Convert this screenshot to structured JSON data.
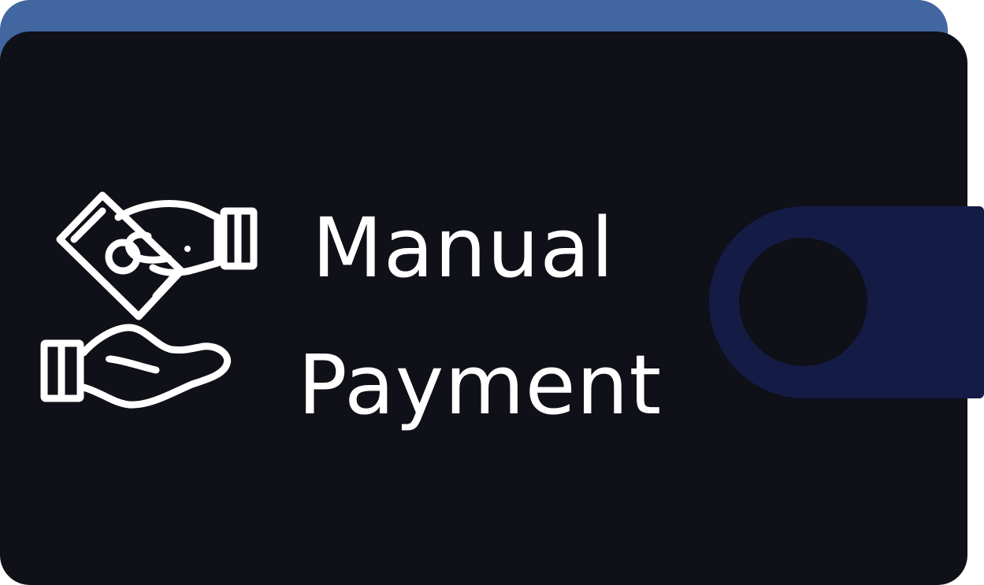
{
  "card": {
    "title_line1": "Manual",
    "title_line2": "Payment"
  },
  "icons": {
    "main": "hand-giving-money-icon"
  },
  "colors": {
    "wallet_back": "#4266a0",
    "wallet_body": "#0f1018",
    "wallet_clasp": "#141c45",
    "text": "#ffffff"
  }
}
